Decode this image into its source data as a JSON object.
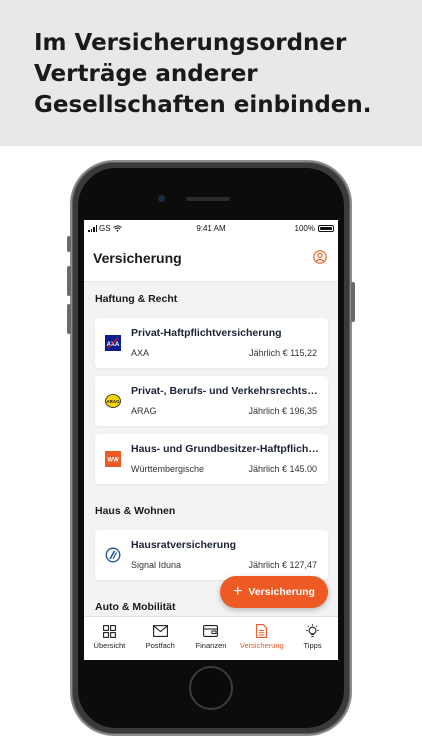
{
  "headline": {
    "line1": "Im Versicherungsordner",
    "line2": "Verträge anderer",
    "line3": "Gesellschaften einbinden."
  },
  "status_bar": {
    "carrier": "GS",
    "time": "9:41 AM",
    "battery": "100%"
  },
  "app_bar": {
    "title": "Versicherung",
    "profile_icon": "profile-icon"
  },
  "sections": [
    {
      "title": "Haftung & Recht",
      "items": [
        {
          "name": "Privat-Haftpflichtversicherung",
          "company": "AXA",
          "price": "Jährlich € 115,22",
          "logo": "AXA",
          "logo_color": "#0a1f8f"
        },
        {
          "name": "Privat-, Berufs- und Verkehrsrechtsschutz",
          "company": "ARAG",
          "price": "Jährlich € 196,35",
          "logo": "ARAG",
          "logo_color": "#f5d400"
        },
        {
          "name": "Haus- und Grundbesitzer-Haftpflichtversicherung",
          "company": "Württembergische",
          "price": "Jährlich € 145.00",
          "logo": "WW",
          "logo_color": "#ee5a24"
        }
      ]
    },
    {
      "title": "Haus & Wohnen",
      "items": [
        {
          "name": "Hausratversicherung",
          "company": "Signal Iduna",
          "price": "Jährlich € 127,47",
          "logo": "",
          "logo_color": "#1d4f9c"
        }
      ]
    },
    {
      "title": "Auto & Mobilität",
      "items": []
    }
  ],
  "fab": {
    "label": "Versicherung",
    "icon": "plus-icon"
  },
  "tabs": [
    {
      "label": "Übersicht",
      "icon": "grid-icon",
      "active": false
    },
    {
      "label": "Postfach",
      "icon": "mail-icon",
      "active": false
    },
    {
      "label": "Finanzen",
      "icon": "wallet-icon",
      "active": false
    },
    {
      "label": "Versicherung",
      "icon": "document-icon",
      "active": true
    },
    {
      "label": "Tipps",
      "icon": "lightbulb-icon",
      "active": false
    }
  ],
  "colors": {
    "accent": "#ee5a24",
    "banner": "#e8e8e8",
    "screen_bg": "#f3f3f3"
  }
}
